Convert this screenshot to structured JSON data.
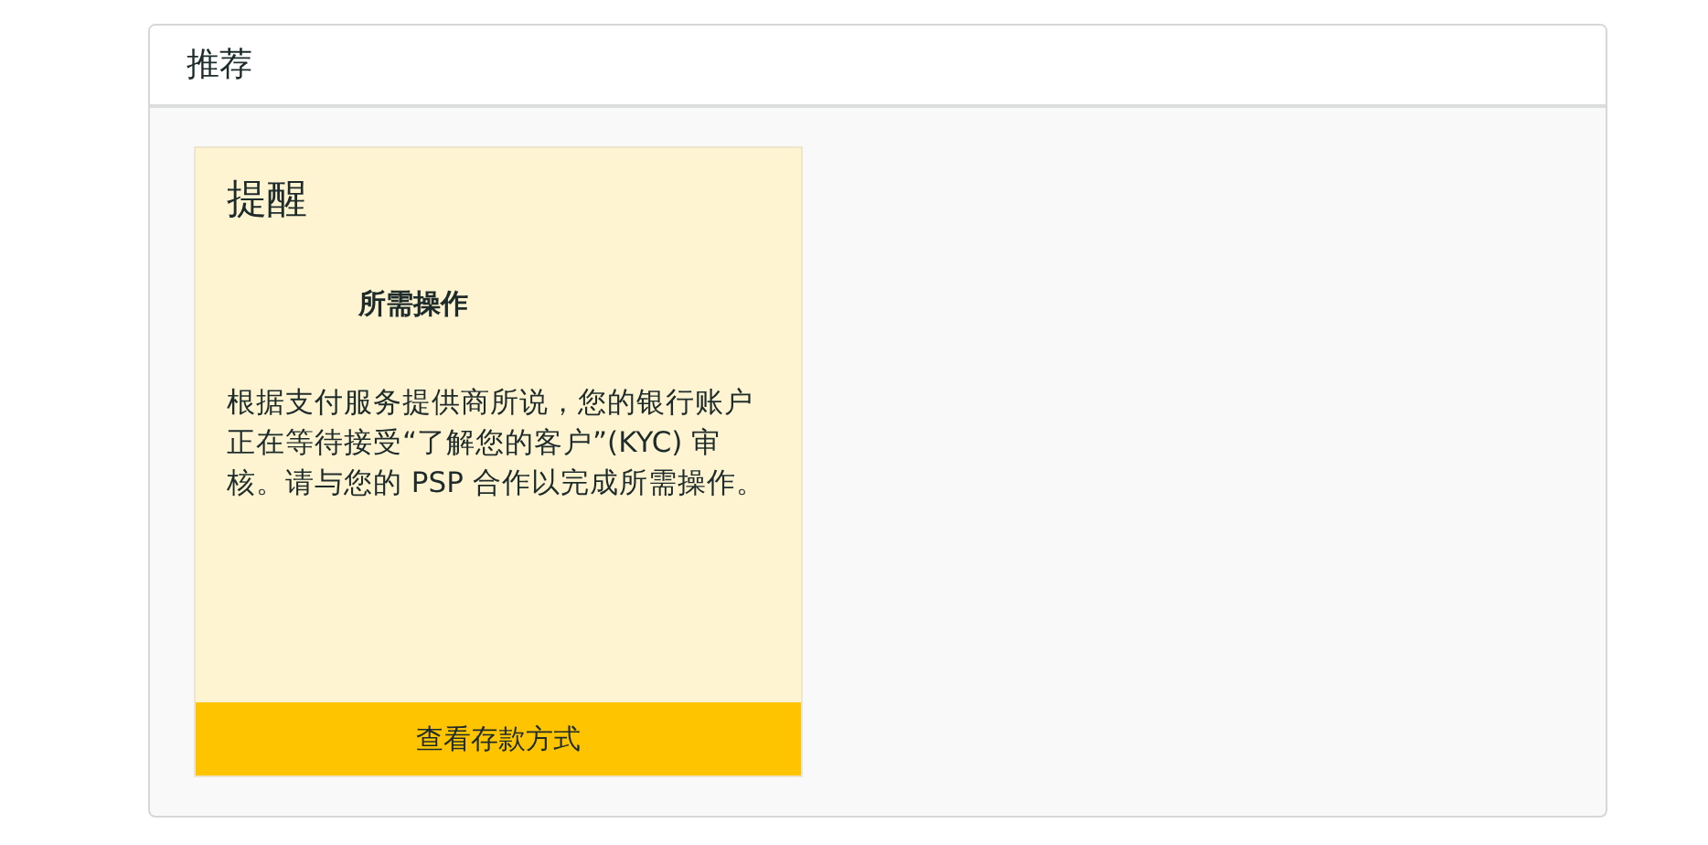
{
  "panel": {
    "title": "推荐"
  },
  "cards": [
    {
      "title": "提醒",
      "subtitle": "所需操作",
      "message": "根据支付服务提供商所说，您的银行账户正在等待接受“了解您的客户”(KYC) 审核。请与您的 PSP 合作以完成所需操作。",
      "button": "查看存款方式"
    }
  ]
}
